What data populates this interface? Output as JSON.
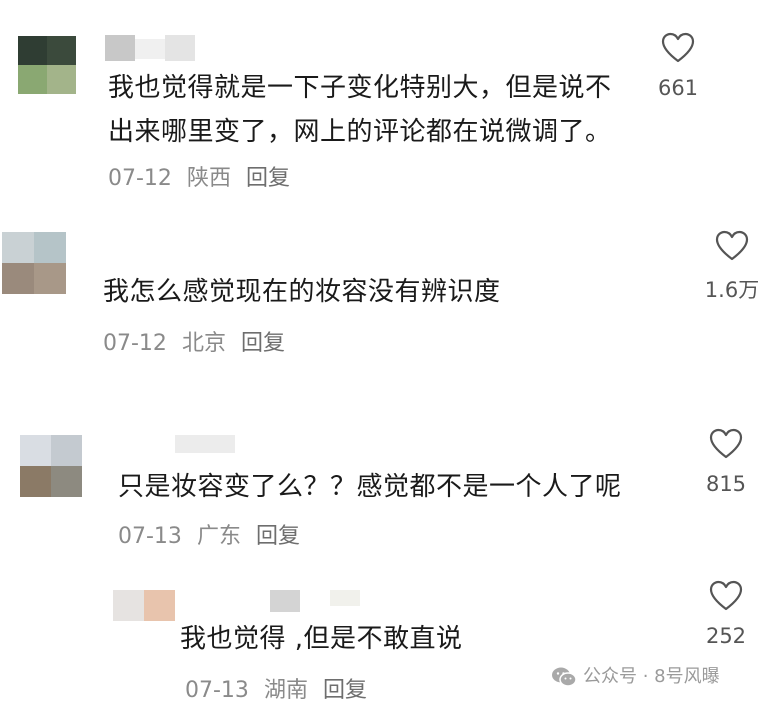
{
  "comments": [
    {
      "lines": [
        "我也觉得就是一下子变化特别大，但是说不",
        "出来哪里变了，网上的评论都在说微调了。"
      ],
      "date": "07-12",
      "location": "陕西",
      "reply": "回复",
      "likes": "661"
    },
    {
      "lines": [
        "我怎么感觉现在的妆容没有辨识度"
      ],
      "date": "07-12",
      "location": "北京",
      "reply": "回复",
      "likes": "1.6万"
    },
    {
      "lines": [
        "只是妆容变了么？？感觉都不是一个人了呢"
      ],
      "date": "07-13",
      "location": "广东",
      "reply": "回复",
      "likes": "815"
    },
    {
      "lines": [
        "我也觉得 ,但是不敢直说"
      ],
      "date": "07-13",
      "location": "湖南",
      "reply": "回复",
      "likes": "252"
    }
  ],
  "watermark": "公众号 · 8号风曝",
  "icons": {
    "like": "heart-icon",
    "watermark": "wechat-icon"
  },
  "colors": {
    "text": "#1a1a1a",
    "meta": "#8a8a8a"
  }
}
